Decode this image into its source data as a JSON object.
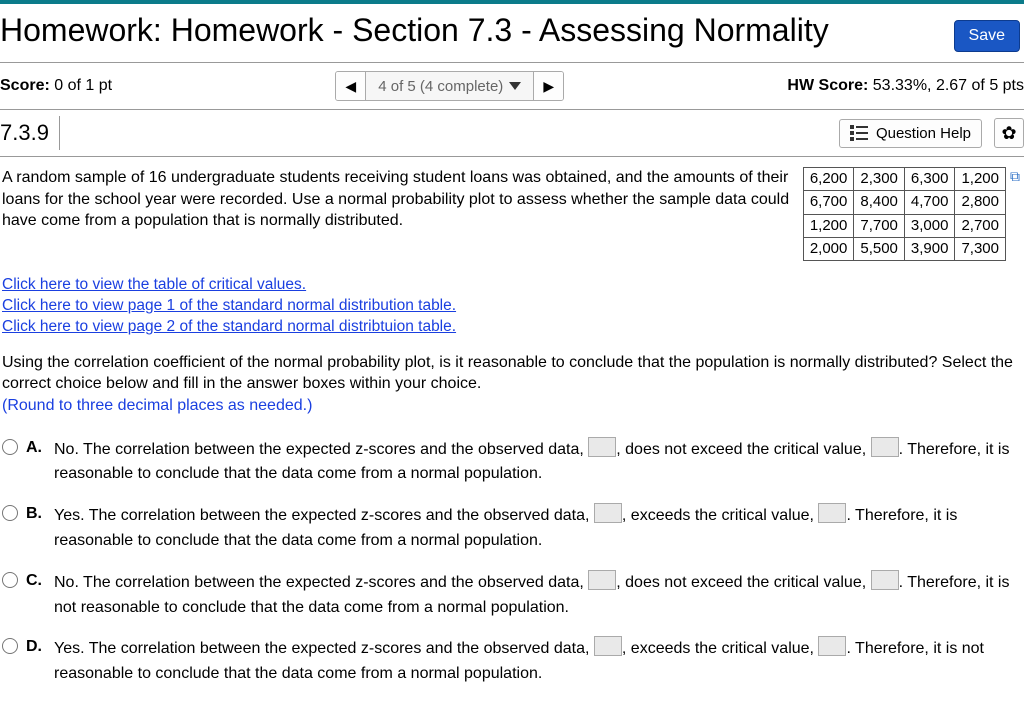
{
  "header": {
    "title": "Homework: Homework - Section 7.3 - Assessing Normality",
    "save_label": "Save"
  },
  "scorebar": {
    "score_label": "Score:",
    "score_value": "0 of 1 pt",
    "progress": "4 of 5 (4 complete)",
    "hw_label": "HW Score:",
    "hw_value": "53.33%, 2.67 of 5 pts"
  },
  "question": {
    "number": "7.3.9",
    "help_label": "Question Help",
    "prompt": "A random sample of 16 undergraduate students receiving student loans was obtained, and the amounts of their loans for the school year were recorded. Use a normal probability plot to assess whether the sample data could have come from a population that is normally distributed.",
    "data_rows": [
      [
        "6,200",
        "2,300",
        "6,300",
        "1,200"
      ],
      [
        "6,700",
        "8,400",
        "4,700",
        "2,800"
      ],
      [
        "1,200",
        "7,700",
        "3,000",
        "2,700"
      ],
      [
        "2,000",
        "5,500",
        "3,900",
        "7,300"
      ]
    ],
    "links": {
      "l1": "Click here to view the table of critical values.",
      "l2": "Click here to view page 1 of the standard normal distribution table.",
      "l3": "Click here to view page 2 of the standard normal distribtuion table."
    },
    "subprompt": "Using the correlation coefficient of the normal probability plot, is it reasonable to conclude that the population is normally distributed? Select the correct choice below and fill in the answer boxes within your choice.",
    "hint": "(Round to three decimal places as needed.)",
    "choices": {
      "a": {
        "letter": "A.",
        "t1": "No. The correlation between the expected z-scores and the observed data, ",
        "t2": ", does not exceed the critical value, ",
        "t3": ". Therefore, it is reasonable to conclude that the data come from a normal population."
      },
      "b": {
        "letter": "B.",
        "t1": "Yes. The correlation between the expected z-scores and the observed data, ",
        "t2": ", exceeds the critical value, ",
        "t3": ". Therefore, it is reasonable to conclude that the data come from a normal population."
      },
      "c": {
        "letter": "C.",
        "t1": "No. The correlation between the expected z-scores and the observed data, ",
        "t2": ", does not exceed the critical value, ",
        "t3": ". Therefore, it is not reasonable to conclude that the data come from a normal population."
      },
      "d": {
        "letter": "D.",
        "t1": "Yes. The correlation between the expected z-scores and the observed data, ",
        "t2": ", exceeds the critical value, ",
        "t3": ". Therefore, it is not reasonable to conclude that the data come from a normal population."
      }
    }
  }
}
